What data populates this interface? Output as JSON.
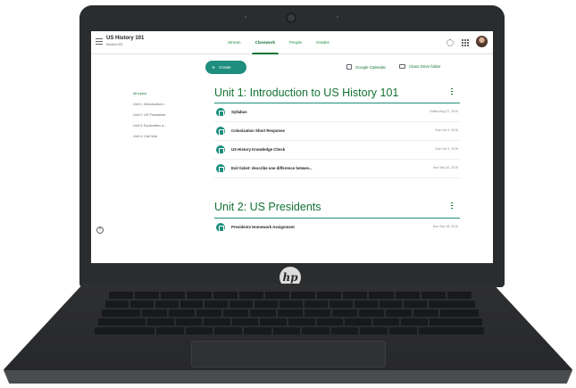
{
  "header": {
    "class_title": "US History 101",
    "class_section": "Section 001",
    "tabs": [
      {
        "label": "Stream"
      },
      {
        "label": "Classwork"
      },
      {
        "label": "People"
      },
      {
        "label": "Grades"
      }
    ],
    "active_tab": "Classwork"
  },
  "toolbar": {
    "create_label": "Create",
    "calendar_label": "Google Calendar",
    "drive_label": "Class Drive folder"
  },
  "topics": [
    {
      "label": "All topics"
    },
    {
      "label": "Unit 1: Introduction t..."
    },
    {
      "label": "Unit 2: US Presidents"
    },
    {
      "label": "Unit 3: Exploration a..."
    },
    {
      "label": "Unit 4: Civil War"
    }
  ],
  "units": [
    {
      "title": "Unit 1: Introduction to US History 101",
      "items": [
        {
          "title": "Syllabus",
          "meta": "Edited Aug 27, 2019"
        },
        {
          "title": "Colonization Short Response",
          "meta": "Due Oct 9, 2019"
        },
        {
          "title": "US History Knowledge Check",
          "meta": "Due Oct 9, 2019"
        },
        {
          "title": "Exit ticket: describe one difference betwee...",
          "meta": "Due Sep 20, 2019"
        }
      ]
    },
    {
      "title": "Unit 2: US Presidents",
      "items": [
        {
          "title": "Presidents Homework Assignment",
          "meta": "Due Sep 18, 2019"
        }
      ]
    }
  ],
  "brand_logo": "hp",
  "colors": {
    "accent": "#137333",
    "primary_button": "#1e8e7e",
    "laptop_body": "#2b2c2e"
  }
}
